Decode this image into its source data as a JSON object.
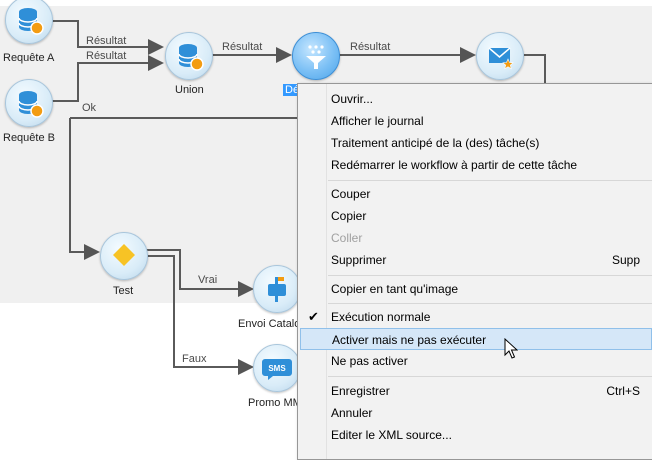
{
  "workflow": {
    "nodes": {
      "requete_a": {
        "label": "Requête A"
      },
      "requete_b": {
        "label": "Requête B"
      },
      "union": {
        "label": "Union"
      },
      "dedup": {
        "label": "Dé"
      },
      "delivery": {
        "label": ""
      },
      "test": {
        "label": "Test"
      },
      "envoi": {
        "label": "Envoi Catalo"
      },
      "promo": {
        "label": "Promo MM",
        "badge": "SMS"
      }
    },
    "links": {
      "reqA_union": "Résultat",
      "reqB_union": "Résultat",
      "union_dedup": "Résultat",
      "dedup_delivery": "Résultat",
      "reqB_ok": "Ok",
      "test_vrai": "Vrai",
      "test_faux": "Faux"
    }
  },
  "context_menu": {
    "items": [
      {
        "label": "Ouvrir..."
      },
      {
        "label": "Afficher le journal"
      },
      {
        "label": "Traitement anticipé de la (des) tâche(s)"
      },
      {
        "label": "Redémarrer le workflow à partir de cette tâche"
      },
      {
        "label": "Couper"
      },
      {
        "label": "Copier"
      },
      {
        "label": "Coller",
        "disabled": true
      },
      {
        "label": "Supprimer",
        "shortcut": "Supp"
      },
      {
        "label": "Copier en tant qu'image"
      },
      {
        "label": "Exécution normale",
        "checked": true
      },
      {
        "label": "Activer mais ne pas exécuter",
        "hover": true
      },
      {
        "label": "Ne pas activer"
      },
      {
        "label": "Enregistrer",
        "shortcut": "Ctrl+S"
      },
      {
        "label": "Annuler"
      },
      {
        "label": "Editer le XML source..."
      }
    ]
  },
  "colors": {
    "accent": "#3399ff",
    "node_icon": "#2f8fd8",
    "orange_badge": "#f39c12",
    "test_diamond": "#f7c325"
  }
}
